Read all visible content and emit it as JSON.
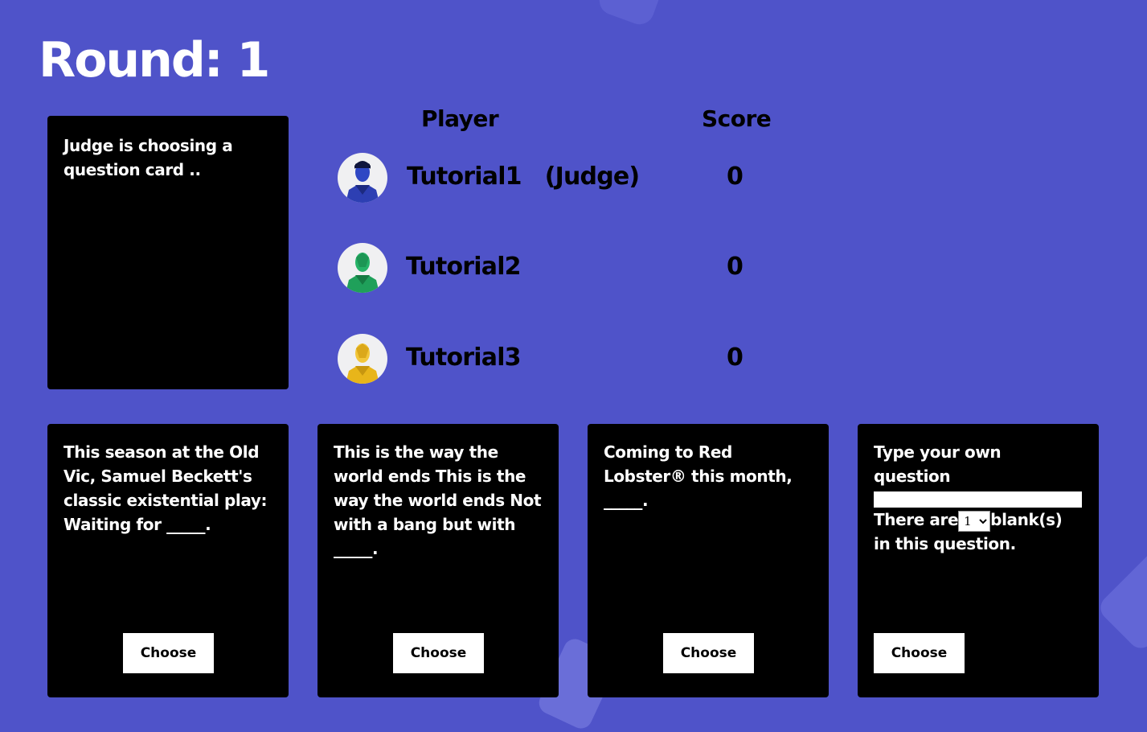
{
  "round": {
    "title": "Round: 1"
  },
  "status": {
    "text": "Judge is choosing a question card .."
  },
  "scoreboard": {
    "player_header": "Player",
    "score_header": "Score",
    "players": [
      {
        "name": "Tutorial1   (Judge)",
        "score": "0",
        "avatar_color": "#2d3fb3",
        "icon": "avatar-blue-icon"
      },
      {
        "name": "Tutorial2",
        "score": "0",
        "avatar_color": "#1fa05a",
        "icon": "avatar-green-icon"
      },
      {
        "name": "Tutorial3",
        "score": "0",
        "avatar_color": "#e8b51a",
        "icon": "avatar-yellow-icon"
      }
    ]
  },
  "question_cards": [
    {
      "text": "This season at the Old Vic, Samuel Beckett's classic existential play: Waiting for _____.",
      "button": "Choose"
    },
    {
      "text": "This is the way the world ends This is the way the world ends Not with a bang but with _____.",
      "button": "Choose"
    },
    {
      "text": "Coming to Red Lobster® this month, _____.",
      "button": "Choose"
    }
  ],
  "custom_card": {
    "heading": "Type your own question",
    "input_value": "",
    "blanks_prefix": "There are",
    "blanks_selected": "1",
    "blanks_suffix": "blank(s) in this question.",
    "button": "Choose"
  },
  "colors": {
    "background": "#4f53c9",
    "card": "#000000",
    "card_text": "#ffffff"
  }
}
